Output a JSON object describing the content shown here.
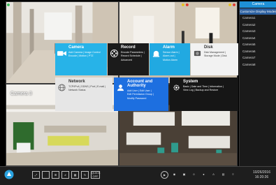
{
  "camera_list": {
    "title": "Camera",
    "mode_button": "Customize Display Modes",
    "items": [
      "Camera1",
      "Camera2",
      "Camera3",
      "Camera4",
      "Camera5",
      "Camera6",
      "Camera7",
      "Camera8"
    ]
  },
  "cameras": {
    "cam3_label": "Camera 3"
  },
  "menu": {
    "camera": {
      "title": "Camera",
      "lines": [
        "Add Camera | Image Control",
        "Encode | Motion | PTZ"
      ]
    },
    "record": {
      "title": "Record",
      "lines": [
        "Encode Parameters |",
        "Record Schedule |",
        "Advanced"
      ]
    },
    "alarm": {
      "title": "Alarm",
      "lines": [
        "Sensor Alarm |",
        "Alarm-out |",
        "Motion Alarm"
      ]
    },
    "disk": {
      "title": "Disk",
      "lines": [
        "Disk Management |",
        "Storage Mode | Disk"
      ]
    },
    "network": {
      "title": "Network",
      "lines": [
        "TCP/IPv4 | DDNS | Port | E-mail |",
        "Network Status"
      ]
    },
    "account": {
      "title": "Account and Authority",
      "lines": [
        "Add User | Edit User |",
        "Edit Permission Group |",
        "Modify Password"
      ]
    },
    "system": {
      "title": "System",
      "lines": [
        "Basic | Date and Time | Information |",
        "View Log | Backup and Restore"
      ]
    }
  },
  "bottom_bar": {
    "quick_label": "QUICK OFF",
    "date": "10/26/2016",
    "time": "16:20:26"
  },
  "colors": {
    "camera_tile": "#27b3e8",
    "alarm_tile": "#21a9e1",
    "account_tile": "#1d6fe0",
    "list_header": "#1e90d6"
  }
}
